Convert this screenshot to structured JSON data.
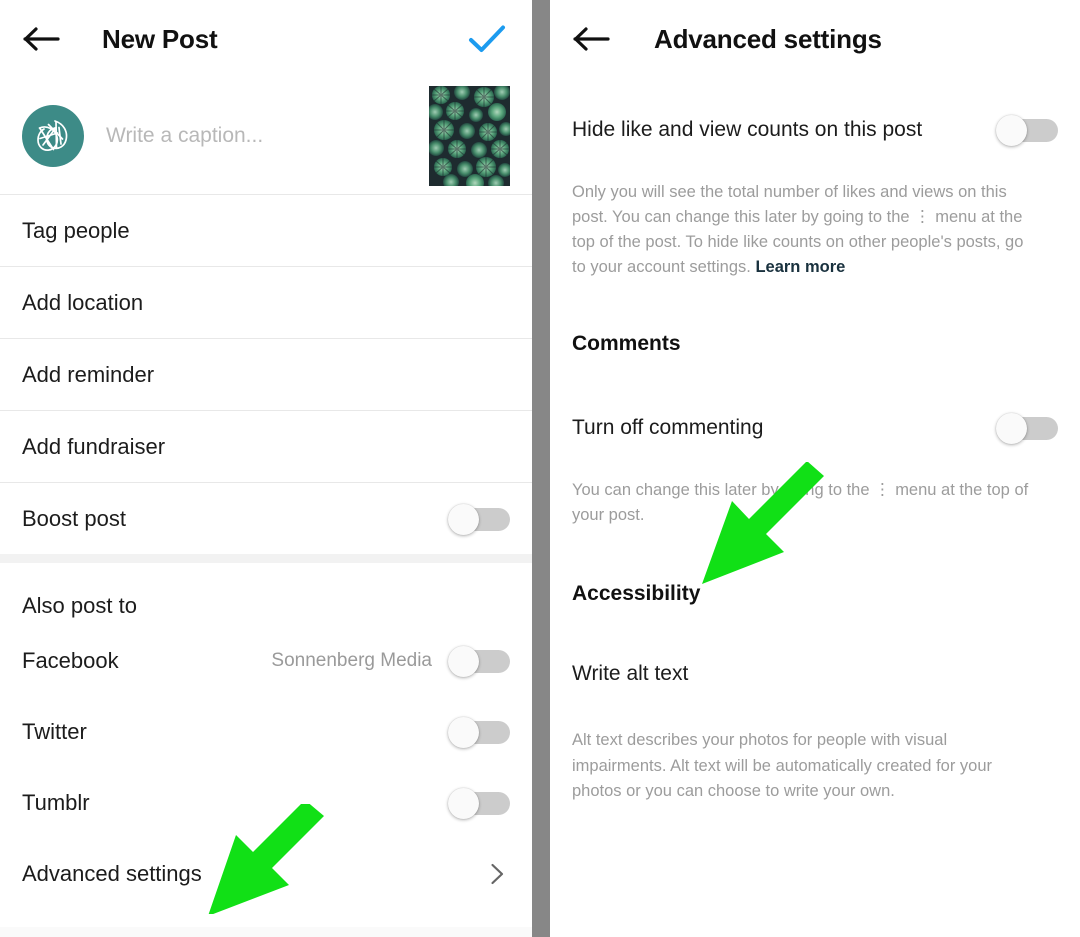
{
  "colors": {
    "accent_check": "#1c9bef",
    "avatar_bg": "#3d8b87",
    "arrow_green": "#11e016",
    "toggle_track": "#cccccc",
    "toggle_knob": "#fafafa",
    "muted_text": "#9c9c9c",
    "divider": "#e8e8e8",
    "gutter": "#878787"
  },
  "left": {
    "header": {
      "back_icon": "arrow-left-icon",
      "title": "New Post",
      "confirm_icon": "check-icon"
    },
    "composer": {
      "avatar_icon": "leaf-logo-avatar",
      "caption_placeholder": "Write a caption...",
      "caption_value": "",
      "thumbnail_alt": "succulent-plants-photo"
    },
    "options": [
      {
        "label": "Tag people",
        "type": "nav"
      },
      {
        "label": "Add location",
        "type": "nav"
      },
      {
        "label": "Add reminder",
        "type": "nav"
      },
      {
        "label": "Add fundraiser",
        "type": "nav"
      },
      {
        "label": "Boost post",
        "type": "toggle",
        "on": false
      }
    ],
    "also_post_to": {
      "heading": "Also post to",
      "items": [
        {
          "label": "Facebook",
          "value": "Sonnenberg Media",
          "on": false
        },
        {
          "label": "Twitter",
          "value": "",
          "on": false
        },
        {
          "label": "Tumblr",
          "value": "",
          "on": false
        }
      ]
    },
    "advanced_settings": {
      "label": "Advanced settings",
      "chevron_icon": "chevron-right-icon"
    }
  },
  "right": {
    "header": {
      "back_icon": "arrow-left-icon",
      "title": "Advanced settings"
    },
    "hide_counts": {
      "label": "Hide like and view counts on this post",
      "on": false,
      "note_before_link": "Only you will see the total number of likes and views on this post. You can change this later by going to the ⋮ menu at the top of the post. To hide like counts on other people's posts, go to your account settings. ",
      "link_text": "Learn more"
    },
    "comments": {
      "heading": "Comments",
      "label": "Turn off commenting",
      "on": false,
      "note": "You can change this later by going to the ⋮ menu at the top of your post."
    },
    "accessibility": {
      "heading": "Accessibility",
      "label": "Write alt text",
      "note": "Alt text describes your photos for people with visual impairments. Alt text will be automatically created for your photos or you can choose to write your own."
    }
  },
  "annotations": {
    "arrow_left_target": "Advanced settings",
    "arrow_right_target": "Write alt text"
  }
}
